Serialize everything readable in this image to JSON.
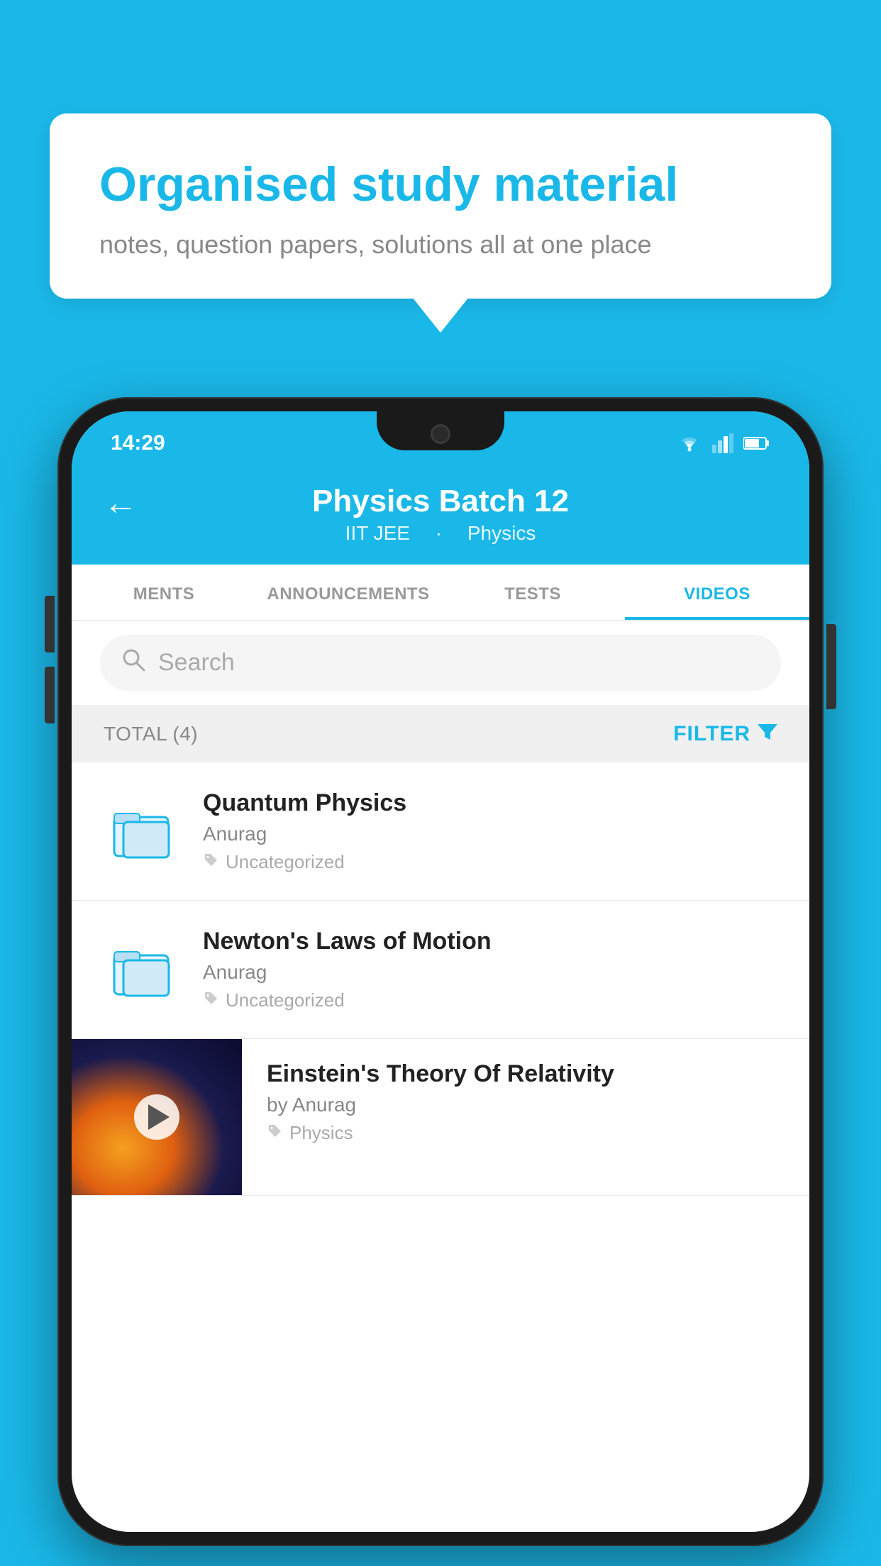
{
  "background_color": "#1ab8e8",
  "speech_bubble": {
    "title": "Organised study material",
    "subtitle": "notes, question papers, solutions all at one place"
  },
  "status_bar": {
    "time": "14:29"
  },
  "app_header": {
    "title": "Physics Batch 12",
    "subtitle_part1": "IIT JEE",
    "subtitle_part2": "Physics",
    "back_label": "←"
  },
  "tabs": [
    {
      "label": "MENTS",
      "active": false
    },
    {
      "label": "ANNOUNCEMENTS",
      "active": false
    },
    {
      "label": "TESTS",
      "active": false
    },
    {
      "label": "VIDEOS",
      "active": true
    }
  ],
  "search": {
    "placeholder": "Search"
  },
  "filter_bar": {
    "total_label": "TOTAL (4)",
    "filter_label": "FILTER"
  },
  "videos": [
    {
      "title": "Quantum Physics",
      "author": "Anurag",
      "tag": "Uncategorized",
      "type": "folder"
    },
    {
      "title": "Newton's Laws of Motion",
      "author": "Anurag",
      "tag": "Uncategorized",
      "type": "folder"
    },
    {
      "title": "Einstein's Theory Of Relativity",
      "author": "by Anurag",
      "tag": "Physics",
      "type": "video"
    }
  ]
}
